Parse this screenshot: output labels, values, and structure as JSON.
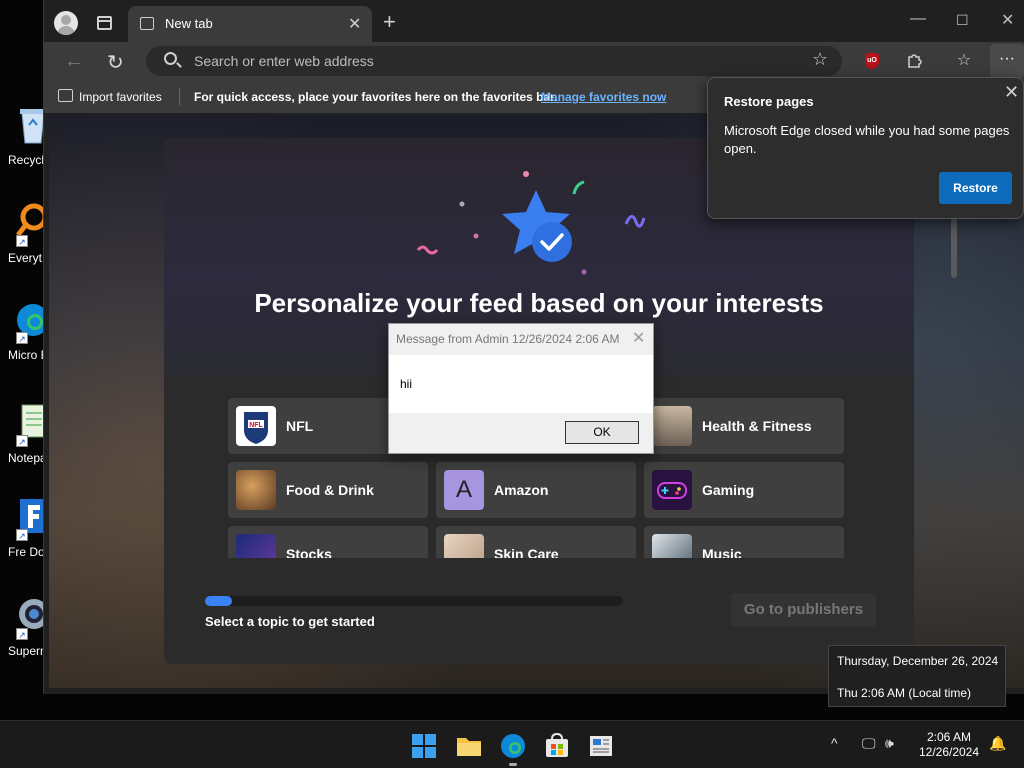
{
  "desktop": {
    "icons": [
      {
        "label": "Recycl",
        "icon": "recycle-bin-icon"
      },
      {
        "label": "Everyt",
        "icon": "everything-search-icon"
      },
      {
        "label": "Micro Edg",
        "icon": "edge-icon"
      },
      {
        "label": "Notepa",
        "icon": "notepad-icon"
      },
      {
        "label": "Fre Down",
        "icon": "download-manager-icon"
      },
      {
        "label": "Superm",
        "icon": "webcam-icon"
      }
    ]
  },
  "browser": {
    "tab_title": "New tab",
    "address_placeholder": "Search or enter web address",
    "favorites_bar": {
      "import_label": "Import favorites",
      "hint": "For quick access, place your favorites here on the favorites bar.",
      "manage_link": "Manage favorites now"
    }
  },
  "feed": {
    "title": "Personalize your feed based on your interests",
    "topics": [
      {
        "label": "NFL",
        "icon": "nfl-logo",
        "color": "#1a3a7a"
      },
      {
        "label": "",
        "icon": "",
        "color": "#3f3f3f"
      },
      {
        "label": "Health & Fitness",
        "icon": "runner-photo",
        "color": "#8a7a6a"
      },
      {
        "label": "Food & Drink",
        "icon": "food-photo",
        "color": "#7a5a3a"
      },
      {
        "label": "Amazon",
        "icon": "letter-a",
        "color": "#8f7ad8"
      },
      {
        "label": "Gaming",
        "icon": "gamepad-icon",
        "color": "#6a2a9a"
      },
      {
        "label": "Stocks",
        "icon": "chart-photo",
        "color": "#2a3a8a"
      },
      {
        "label": "Skin Care",
        "icon": "skincare-photo",
        "color": "#c9b29a"
      },
      {
        "label": "Music",
        "icon": "music-photo",
        "color": "#5a6a7a"
      }
    ],
    "amazon_letter": "A",
    "progress_fraction": 0.065,
    "cta": "Select a topic to get started",
    "go_publishers": "Go to publishers"
  },
  "restore_popup": {
    "title": "Restore pages",
    "body": "Microsoft Edge closed while you had some pages open.",
    "button": "Restore"
  },
  "message_box": {
    "title": "Message from Admin 12/26/2024 2:06 AM",
    "text": "hii",
    "ok": "OK"
  },
  "clock_tooltip": {
    "date_long": "Thursday, December 26, 2024",
    "time_local": "Thu 2:06 AM (Local time)"
  },
  "taskbar": {
    "time": "2:06 AM",
    "date": "12/26/2024"
  }
}
